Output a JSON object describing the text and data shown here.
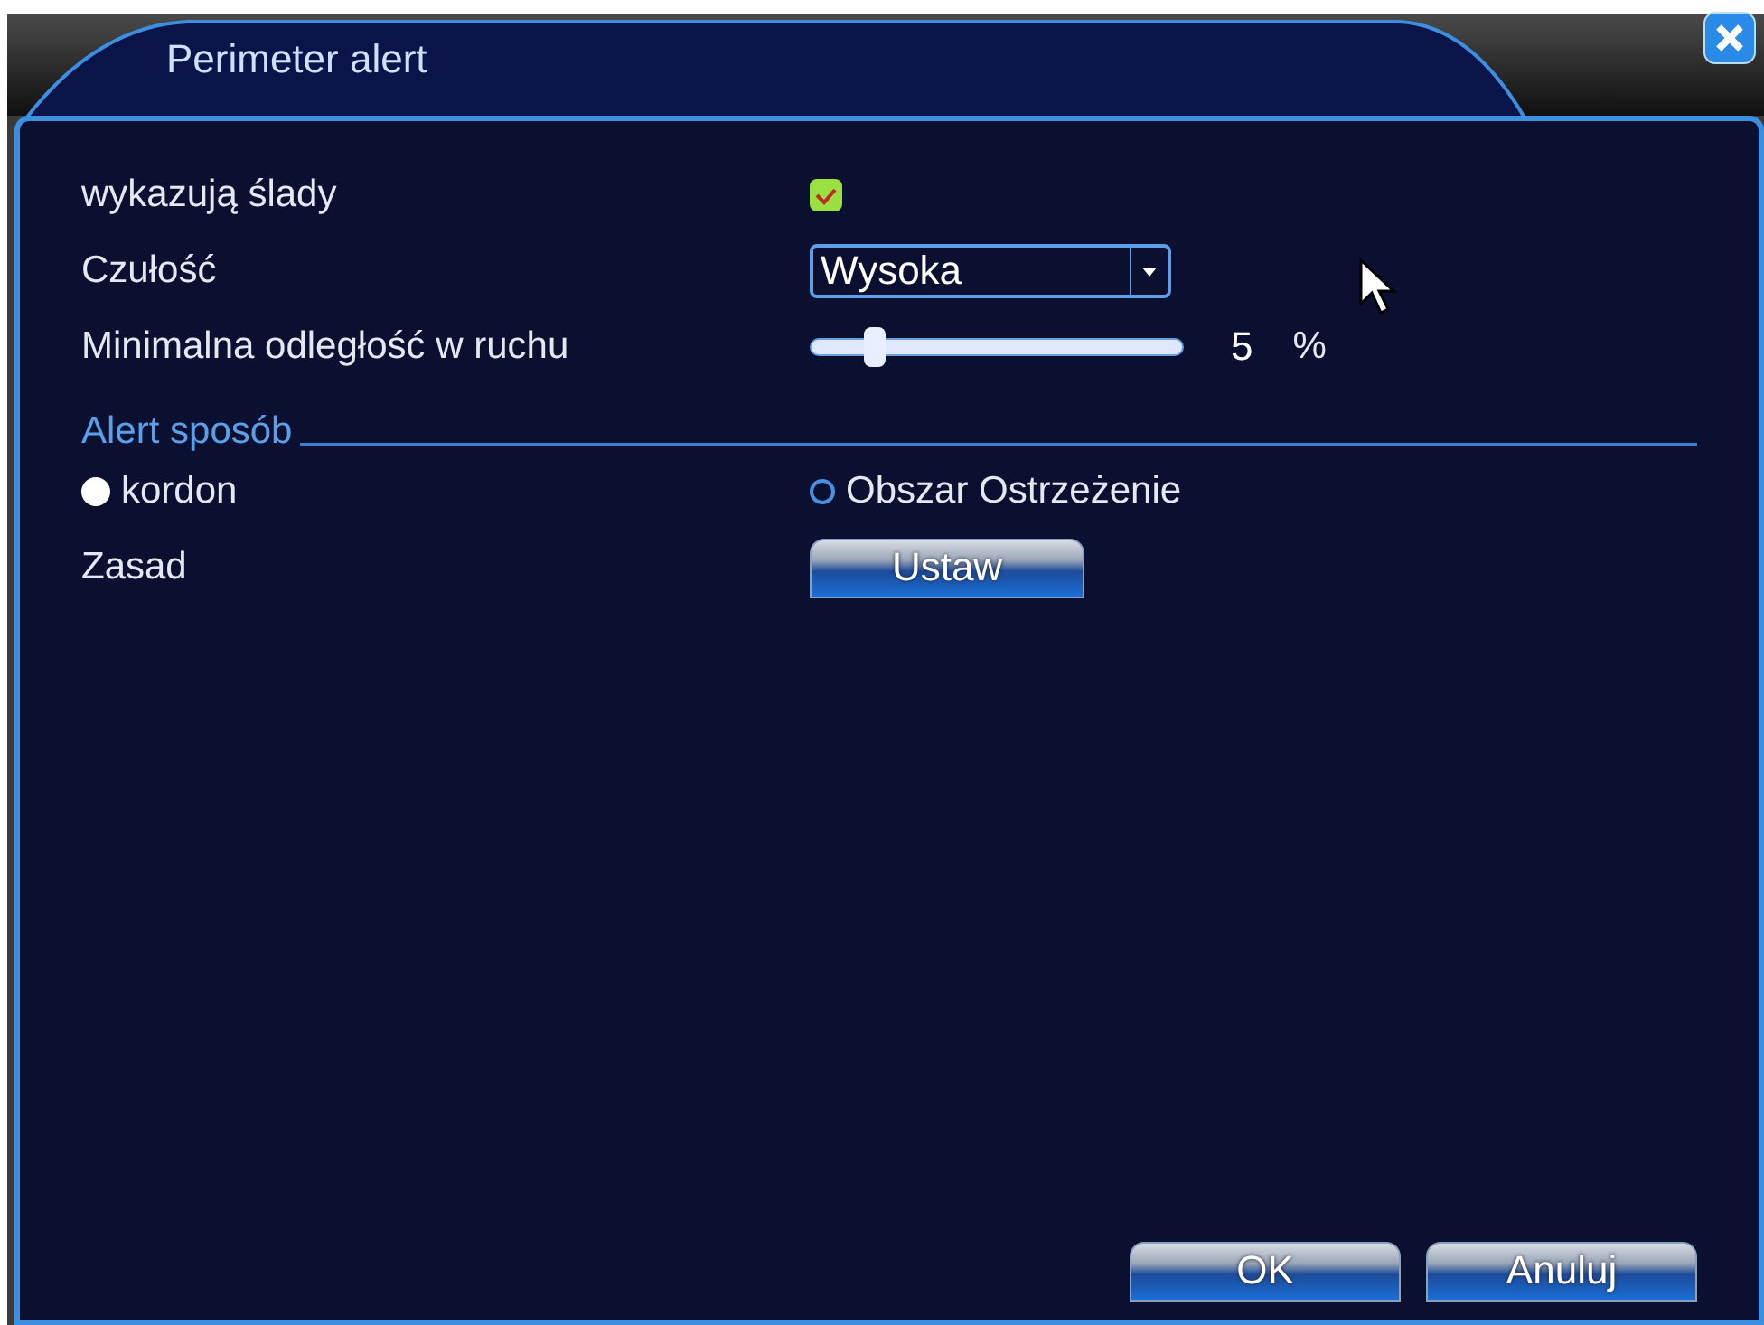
{
  "window": {
    "title": "Perimeter alert"
  },
  "settings": [
    {
      "kind": "checkbox",
      "label": "wykazują ślady",
      "checked": true
    },
    {
      "kind": "dropdown",
      "label": "Czułość",
      "value": "Wysoka"
    },
    {
      "kind": "slider",
      "label": "Minimalna odległość w ruchu",
      "level": 0.17,
      "reading": "5",
      "unit": "%"
    }
  ],
  "alert_mode": {
    "heading": "Alert sposób",
    "options": [
      {
        "label": "kordon",
        "selected": true
      },
      {
        "label": "Obszar Ostrzeżenie",
        "selected": false
      }
    ],
    "rule": {
      "label": "Zasad",
      "button": "Ustaw"
    }
  },
  "buttons": [
    "OK",
    "Anuluj"
  ]
}
